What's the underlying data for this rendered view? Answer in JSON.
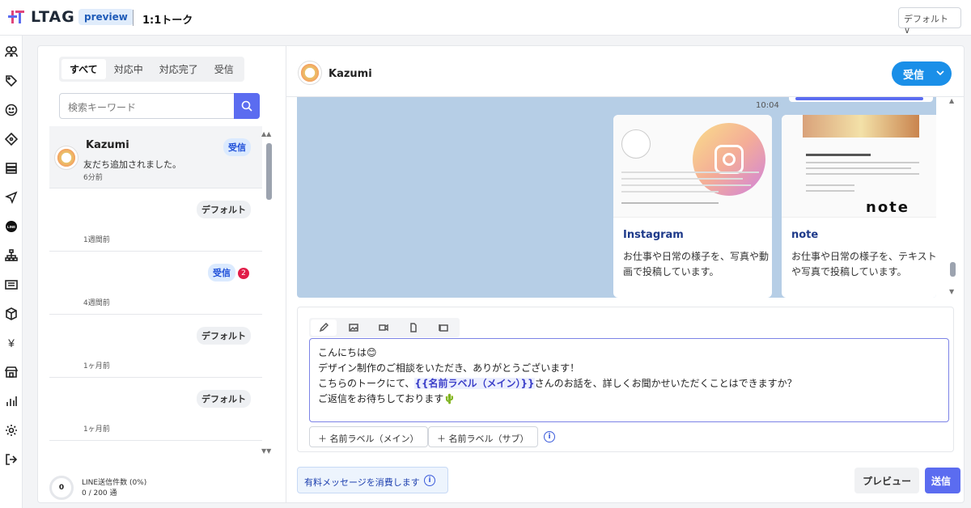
{
  "app": {
    "logo_text": "LTAG",
    "preview_label": "preview",
    "page_title": "1:1トーク",
    "account_select": "デフォルト ∨"
  },
  "tabs": [
    "すべて",
    "対応中",
    "対応完了",
    "受信"
  ],
  "search": {
    "placeholder": "検索キーワード"
  },
  "conversations": [
    {
      "name": "Kazumi",
      "message": "友だち追加されました。",
      "time": "6分前",
      "status": "受信"
    },
    {
      "status": "デフォルト",
      "time": "1週間前"
    },
    {
      "status": "受信",
      "count": "2",
      "time": "4週間前"
    },
    {
      "status": "デフォルト",
      "time": "1ヶ月前"
    },
    {
      "status": "デフォルト",
      "time": "1ヶ月前"
    }
  ],
  "footer": {
    "count": "0",
    "line_label": "LINE送信件数 (0%)",
    "line_value": "0 / 200 通"
  },
  "chat": {
    "name": "Kazumi",
    "status_button": "受信",
    "timestamp": "10:04",
    "cards": [
      {
        "title": "Instagram",
        "desc": "お仕事や日常の様子を、写真や動画で投稿しています。"
      },
      {
        "title": "note",
        "desc": "お仕事や日常の様子を、テキストや写真で投稿しています。"
      }
    ]
  },
  "composer": {
    "line1": "こんにちは😊",
    "line2": "デザイン制作のご相談をいただき、ありがとうございます！",
    "line3_prefix": "こちらのトークにて、",
    "line3_tag": "{{名前ラベル（メイン）}}",
    "line3_suffix": "さんのお話を、詳しくお聞かせいただくことはできますか？",
    "line4": "ご返信をお待ちしております🌵",
    "tag_main": "＋ 名前ラベル（メイン）",
    "tag_sub": "＋ 名前ラベル（サブ）"
  },
  "bottom": {
    "paid": "有料メッセージを消費します",
    "preview": "プレビュー",
    "send": "送信"
  },
  "colors": {
    "primary": "#5b6cf0",
    "recv": "#1a8fe8",
    "chat_bg": "#b6cee6"
  }
}
